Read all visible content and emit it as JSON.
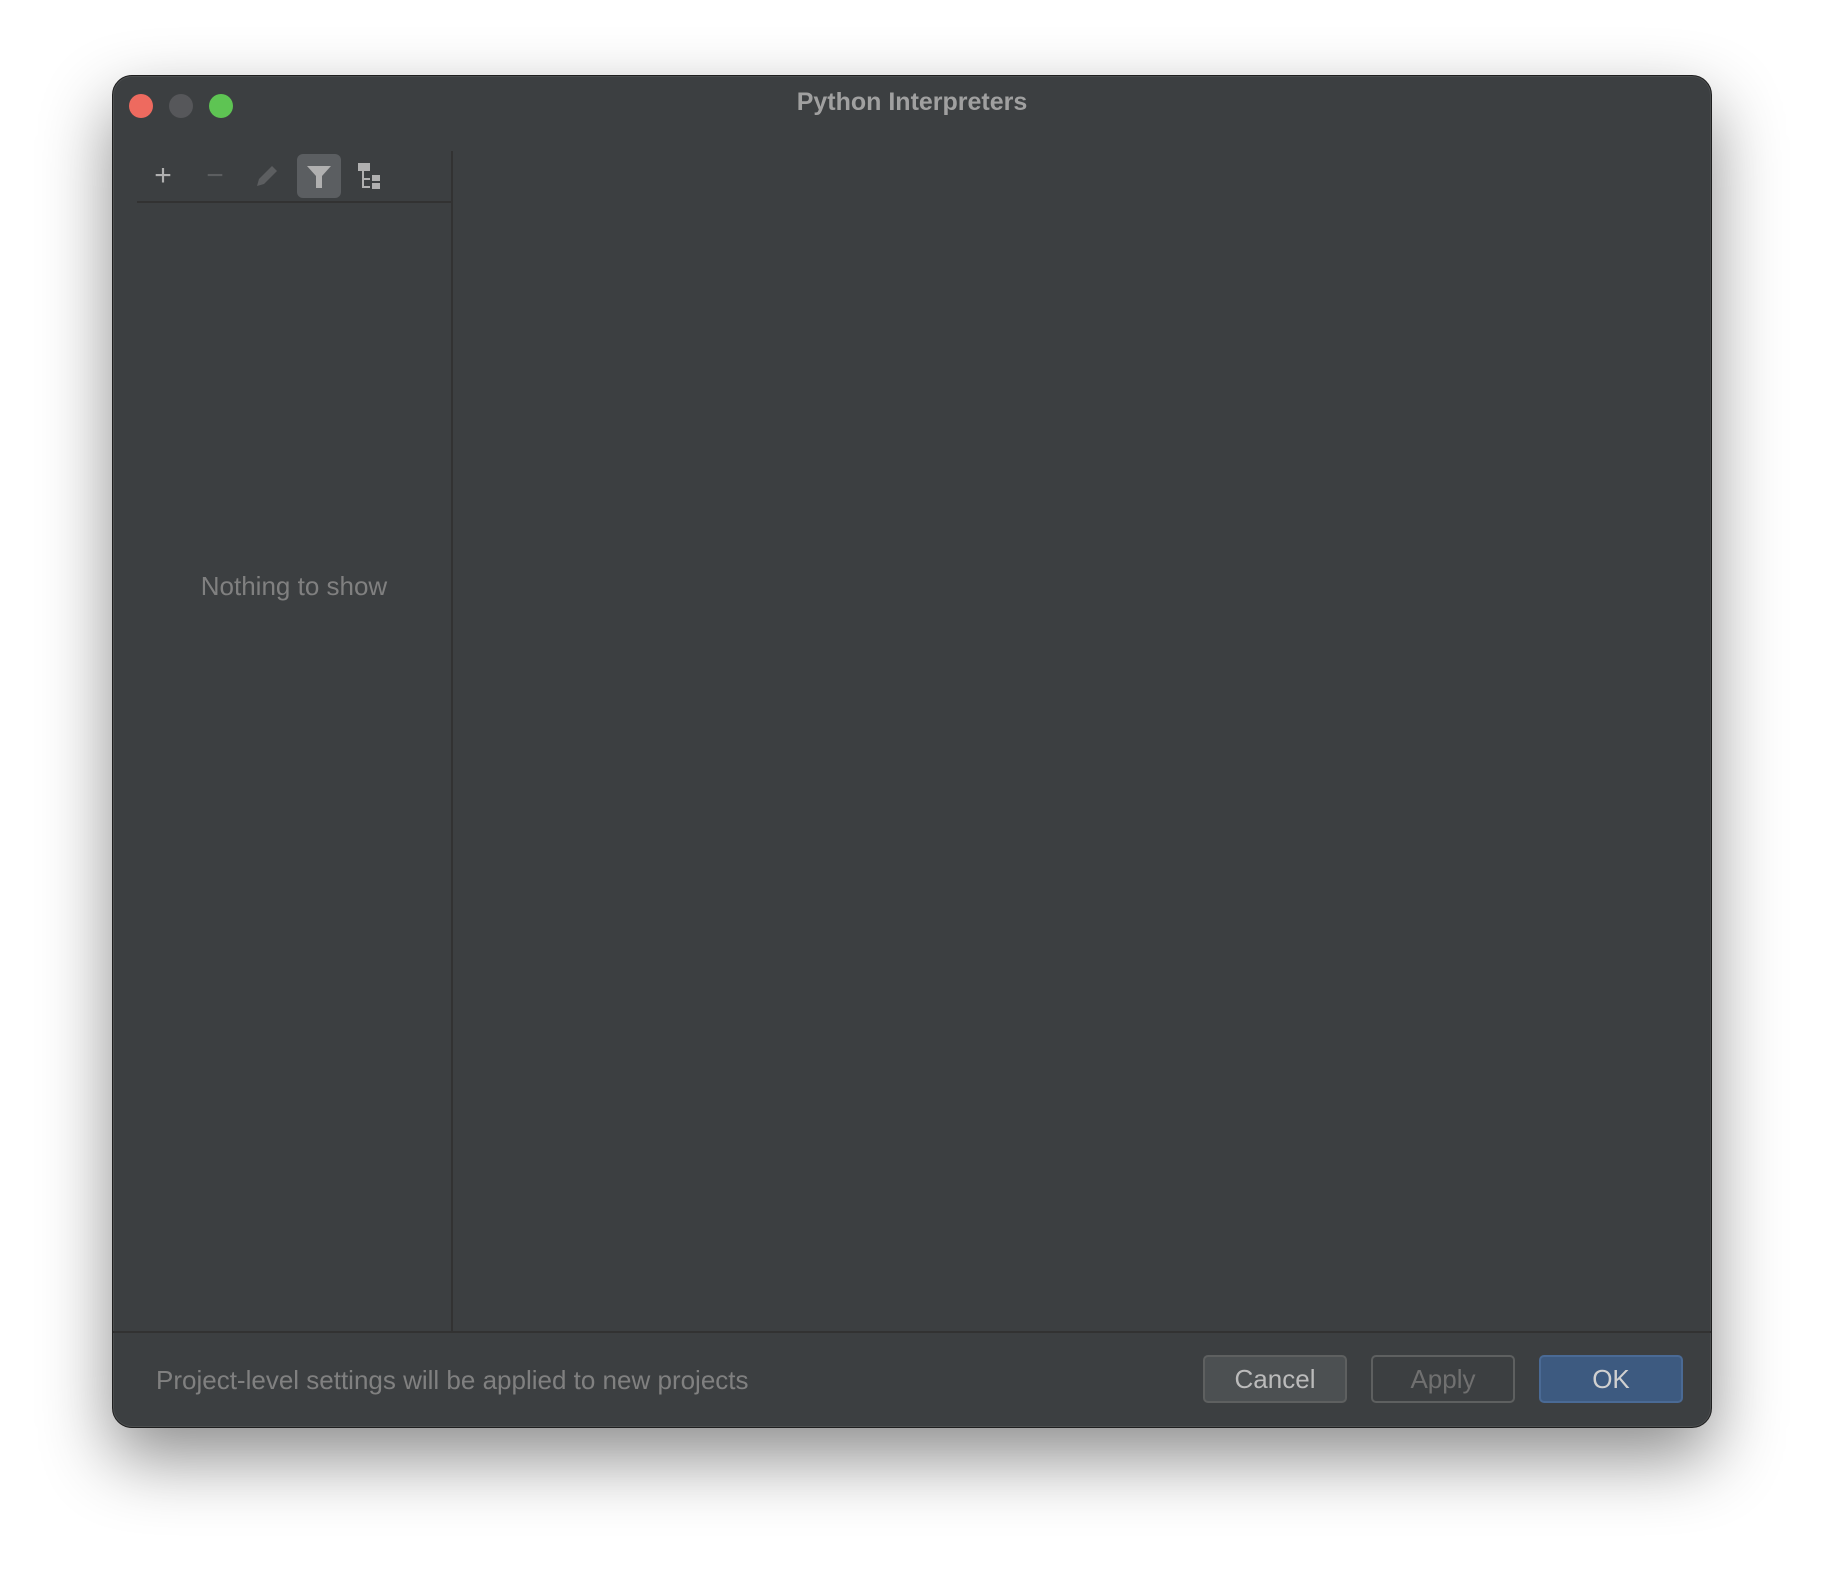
{
  "window": {
    "title": "Python Interpreters"
  },
  "toolbar": {
    "add": "+",
    "remove": "−"
  },
  "list": {
    "empty_text": "Nothing to show"
  },
  "footer": {
    "message": "Project-level settings will be applied to new projects",
    "cancel_label": "Cancel",
    "apply_label": "Apply",
    "ok_label": "OK"
  },
  "colors": {
    "accent": "#3d5a80",
    "close": "#ee6a5f",
    "maximize": "#5ec453"
  }
}
